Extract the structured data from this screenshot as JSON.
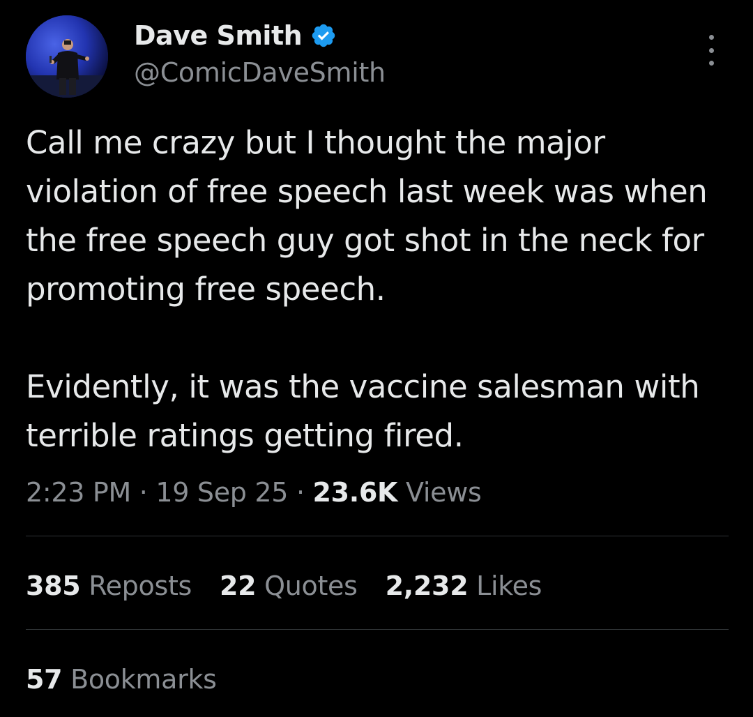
{
  "author": {
    "display_name": "Dave Smith",
    "handle": "@ComicDaveSmith",
    "verified": true,
    "verified_color": "#1d9bf0"
  },
  "tweet": {
    "paragraphs": [
      "Call me crazy but I thought the major violation of free speech last week was when the free speech guy got shot in the neck for promoting free speech.",
      "Evidently, it was the vaccine salesman with terrible ratings getting fired."
    ]
  },
  "meta": {
    "time": "2:23 PM",
    "separator": "·",
    "date": "19 Sep 25",
    "views_count": "23.6K",
    "views_label": "Views"
  },
  "stats": {
    "reposts_count": "385",
    "reposts_label": "Reposts",
    "quotes_count": "22",
    "quotes_label": "Quotes",
    "likes_count": "2,232",
    "likes_label": "Likes",
    "bookmarks_count": "57",
    "bookmarks_label": "Bookmarks"
  },
  "icons": {
    "more": "more-options-icon",
    "verified": "verified-badge-icon"
  },
  "colors": {
    "background": "#000000",
    "primary_text": "#e7e9ea",
    "secondary_text": "#8b8f94",
    "divider": "#2f3336"
  }
}
